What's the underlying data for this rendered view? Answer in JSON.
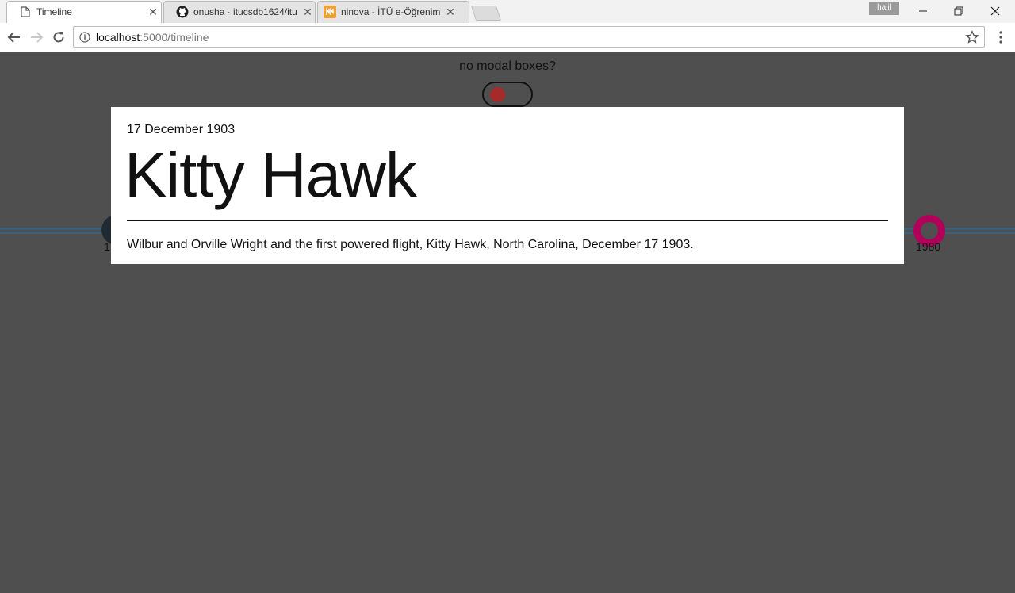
{
  "browser": {
    "tabs": [
      {
        "title": "Timeline",
        "active": true,
        "icon": "page-icon"
      },
      {
        "title": "onusha · itucsdb1624/itu",
        "active": false,
        "icon": "github-icon"
      },
      {
        "title": "ninova - İTÜ e-Öğrenim M",
        "active": false,
        "icon": "ninova-icon"
      }
    ],
    "profile_name": "halil",
    "url_host": "localhost",
    "url_rest": ":5000/timeline"
  },
  "page": {
    "toggle_label": "no modal boxes?",
    "toggle_on": false,
    "timeline": {
      "visible_year_right": "1980",
      "visible_year_left_fragment": "1"
    }
  },
  "modal": {
    "date": "17 December 1903",
    "title": "Kitty Hawk",
    "description": "Wilbur and Orville Wright and the first powered flight, Kitty Hawk, North Carolina, December 17 1903."
  },
  "colors": {
    "overlay_background": "#4f4f4f",
    "timeline_line": "#3d5f79",
    "marker_right": "#b0005a",
    "marker_left": "#1f2a33",
    "toggle_knob": "#a52a2a"
  }
}
